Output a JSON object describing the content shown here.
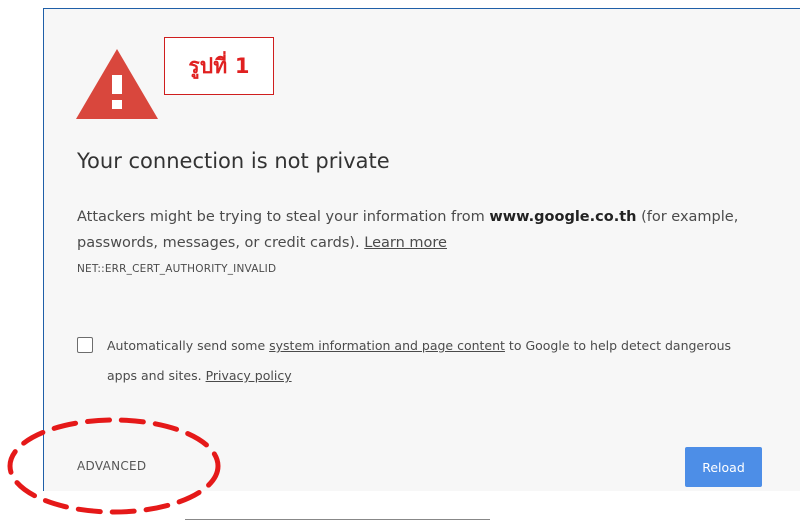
{
  "annotation": {
    "label": "รูปที่ 1"
  },
  "interstitial": {
    "title": "Your connection is not private",
    "description_prefix": "Attackers might be trying to steal your information from ",
    "host": "www.google.co.th",
    "description_suffix": " (for example, passwords, messages, or credit cards).",
    "learn_more": "Learn more",
    "error_code": "NET::ERR_CERT_AUTHORITY_INVALID",
    "checkbox_prefix": "Automatically send some ",
    "checkbox_link": "system information and page content",
    "checkbox_middle": " to Google to help detect dangerous apps and sites.",
    "privacy_link": "Privacy policy",
    "advanced_label": "ADVANCED",
    "reload_label": "Reload"
  },
  "icons": {
    "warning": "warning-triangle-icon",
    "checkbox": "checkbox-unchecked"
  },
  "colors": {
    "warning_red": "#d9473d",
    "reload_blue": "#4d8ee7",
    "annotation_red": "#e02020",
    "panel_background": "#f7f7f7"
  }
}
